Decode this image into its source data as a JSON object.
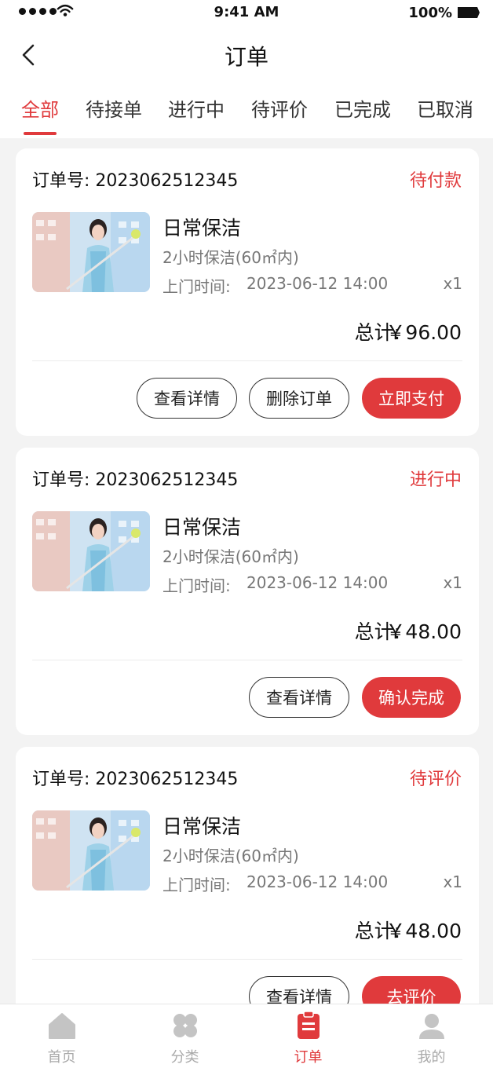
{
  "status_bar": {
    "time": "9:41 AM",
    "battery": "100%"
  },
  "nav": {
    "title": "订单"
  },
  "tabs": [
    {
      "label": "全部",
      "active": true
    },
    {
      "label": "待接单",
      "active": false
    },
    {
      "label": "进行中",
      "active": false
    },
    {
      "label": "待评价",
      "active": false
    },
    {
      "label": "已完成",
      "active": false
    },
    {
      "label": "已取消",
      "active": false
    }
  ],
  "orders": [
    {
      "order_no": "订单号: 2023062512345",
      "status": "待付款",
      "service_name": "日常保洁",
      "spec": "2小时保洁(60㎡内)",
      "time_label": "上门时间:",
      "time": "2023-06-12 14:00",
      "qty": "x1",
      "total_label": "总计:",
      "total": "￥96.00",
      "buttons": [
        "查看详情",
        "删除订单",
        "立即支付"
      ]
    },
    {
      "order_no": "订单号: 2023062512345",
      "status": "进行中",
      "service_name": "日常保洁",
      "spec": "2小时保洁(60㎡内)",
      "time_label": "上门时间:",
      "time": "2023-06-12 14:00",
      "qty": "x1",
      "total_label": "总计:",
      "total": "￥48.00",
      "buttons": [
        "查看详情",
        "确认完成"
      ]
    },
    {
      "order_no": "订单号: 2023062512345",
      "status": "待评价",
      "service_name": "日常保洁",
      "spec": "2小时保洁(60㎡内)",
      "time_label": "上门时间:",
      "time": "2023-06-12 14:00",
      "qty": "x1",
      "total_label": "总计:",
      "total": "￥48.00",
      "buttons": [
        "查看详情",
        "去评价"
      ]
    }
  ],
  "tabbar": [
    {
      "label": "首页",
      "icon": "home-icon",
      "active": false
    },
    {
      "label": "分类",
      "icon": "category-icon",
      "active": false
    },
    {
      "label": "订单",
      "icon": "orders-icon",
      "active": true
    },
    {
      "label": "我的",
      "icon": "profile-icon",
      "active": false
    }
  ],
  "colors": {
    "accent": "#e03a3c",
    "background": "#f3f3f3",
    "muted": "#777777"
  }
}
